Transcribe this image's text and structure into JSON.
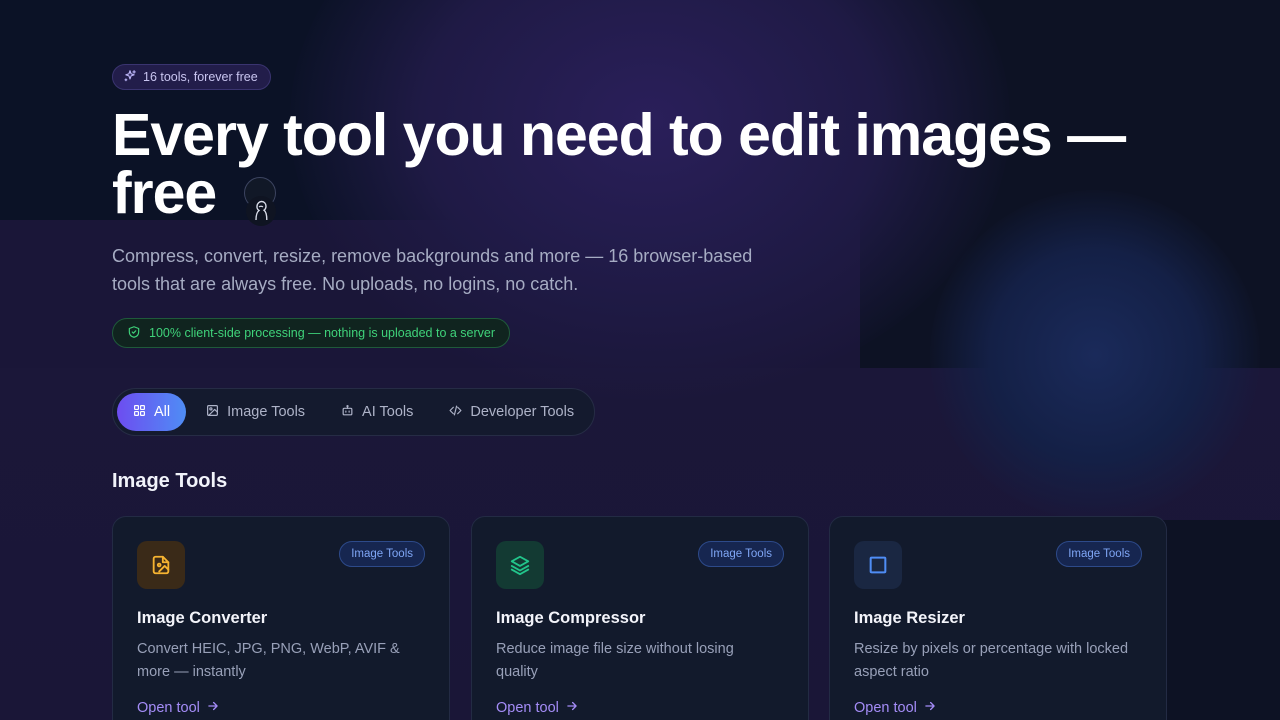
{
  "hero": {
    "badge_label": "16 tools, forever free",
    "title_line1": "Every tool you need to edit images —",
    "title_line2": "free",
    "subtitle": "Compress, convert, resize, remove backgrounds and more — 16 browser-based tools that are always free. No uploads, no logins, no catch.",
    "privacy_note": "100% client-side processing — nothing is uploaded to a server"
  },
  "filters": [
    {
      "label": "All",
      "icon": "grid-icon",
      "active": true
    },
    {
      "label": "Image Tools",
      "icon": "image-icon",
      "active": false
    },
    {
      "label": "AI Tools",
      "icon": "robot-icon",
      "active": false
    },
    {
      "label": "Developer Tools",
      "icon": "code-icon",
      "active": false
    }
  ],
  "section": {
    "title": "Image Tools"
  },
  "cards": [
    {
      "title": "Image Converter",
      "description": "Convert HEIC, JPG, PNG, WebP, AVIF & more — instantly",
      "category": "Image Tools",
      "link_label": "Open tool",
      "icon": "file-image-icon",
      "accent": "#f5b331"
    },
    {
      "title": "Image Compressor",
      "description": "Reduce image file size without losing quality",
      "category": "Image Tools",
      "link_label": "Open tool",
      "icon": "layers-icon",
      "accent": "#22c58b"
    },
    {
      "title": "Image Resizer",
      "description": "Resize by pixels or percentage with locked aspect ratio",
      "category": "Image Tools",
      "link_label": "Open tool",
      "icon": "square-icon",
      "accent": "#4f8df5"
    }
  ],
  "colors": {
    "accent_purple": "#6d4df0",
    "accent_blue": "#4f8df5",
    "success_green": "#3fd27a",
    "link_purple": "#a48cf7"
  }
}
